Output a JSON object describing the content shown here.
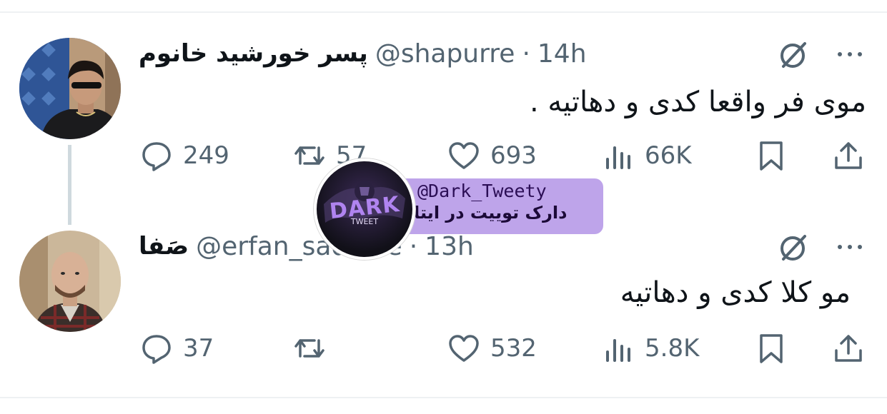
{
  "tweets": [
    {
      "name": "پسر خورشید خانوم",
      "handle": "@shapurre",
      "separator": "·",
      "time": "14h",
      "text": "موی فر واقعا کدی و دهاتیه .",
      "replies": "249",
      "reposts": "57",
      "likes": "693",
      "views": "66K",
      "avatar": "avatar-man-sunglasses"
    },
    {
      "name": "صَفا",
      "handle": "@erfan_sadeiee",
      "separator": "·",
      "time": "13h",
      "text": "مو کلا کدی و دهاتیه",
      "replies": "37",
      "reposts": "",
      "likes": "532",
      "views": "5.8K",
      "avatar": "avatar-bald-man"
    }
  ],
  "watermark": {
    "handle": "@Dark_Tweety",
    "subtitle": "دارک توییت در ایتا",
    "logo_main": "DARK",
    "logo_sub": "TWEET"
  },
  "icons": {
    "reply": "reply-icon",
    "repost": "repost-icon",
    "like": "like-icon",
    "views": "views-icon",
    "bookmark": "bookmark-icon",
    "share": "share-icon",
    "grok": "grok-icon",
    "more": "more-icon"
  },
  "colors": {
    "text": "#0f1419",
    "secondary": "#536471",
    "thread_line": "#cfd9de",
    "watermark_band": "#b99ce8"
  }
}
